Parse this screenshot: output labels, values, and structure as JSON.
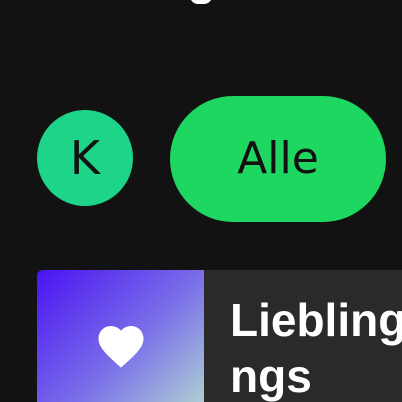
{
  "header": {
    "profile_initial": "K"
  },
  "filters": {
    "all_label": "Alle"
  },
  "shortcuts": [
    {
      "title": "Lieblingsongs",
      "icon": "heart-icon"
    }
  ],
  "colors": {
    "background": "#121212",
    "avatar": "#1ed488",
    "chip_active": "#1ed760",
    "card": "#2a2a2a",
    "cover_gradient_start": "#4a12f2",
    "cover_gradient_end": "#b4dbd0"
  }
}
